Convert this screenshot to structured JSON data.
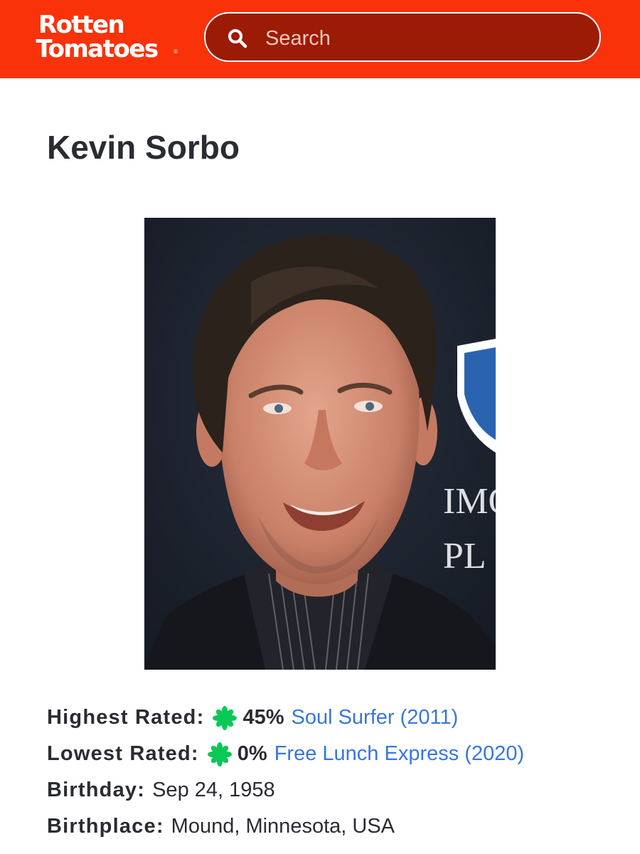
{
  "brand": {
    "line1": "Rotten",
    "line2": "Tomatoes",
    "registered": "®",
    "color": "#fa320a"
  },
  "search": {
    "placeholder": "Search",
    "value": ""
  },
  "celebrity": {
    "name": "Kevin Sorbo",
    "photo_backdrop_text": [
      "IMO",
      "PL"
    ]
  },
  "facts": {
    "highest": {
      "label": "Highest Rated:",
      "score": "45%",
      "title": "Soul Surfer (2011)",
      "icon": "rotten-splat-icon"
    },
    "lowest": {
      "label": "Lowest Rated:",
      "score": "0%",
      "title": "Free Lunch Express (2020)",
      "icon": "rotten-splat-icon"
    },
    "birthday": {
      "label": "Birthday:",
      "value": "Sep 24, 1958"
    },
    "birthplace": {
      "label": "Birthplace:",
      "value": "Mound, Minnesota, USA"
    }
  },
  "colors": {
    "link": "#3976dc",
    "splat": "#0ac855",
    "header": "#fa320a",
    "search_bg": "#9c1b05"
  }
}
